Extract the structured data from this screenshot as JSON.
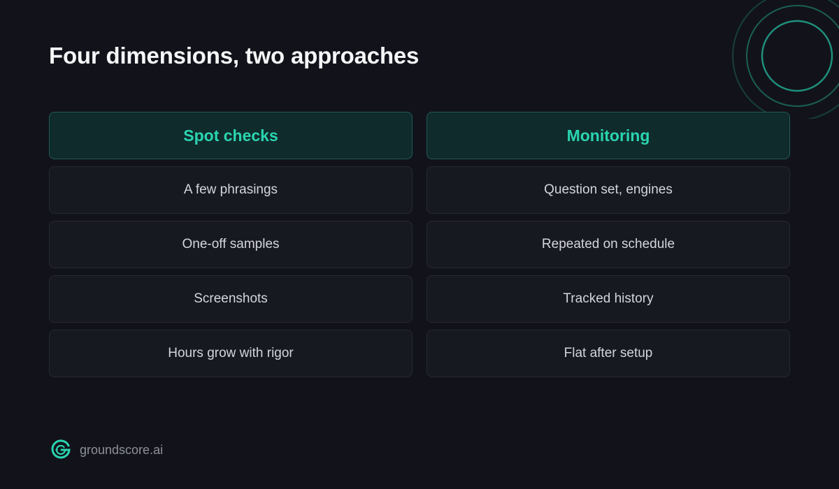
{
  "title": "Four dimensions, two approaches",
  "columns": [
    {
      "header": "Spot checks",
      "rows": [
        "A few phrasings",
        "One-off samples",
        "Screenshots",
        "Hours grow with rigor"
      ]
    },
    {
      "header": "Monitoring",
      "rows": [
        "Question set, engines",
        "Repeated on schedule",
        "Tracked history",
        "Flat after setup"
      ]
    }
  ],
  "brand": {
    "name": "groundscore.ai",
    "logo_icon": "groundscore-g-logo-icon",
    "decoration_icon": "concentric-arcs-icon"
  },
  "colors": {
    "background": "#12131a",
    "accent": "#2ad5b1",
    "header_fill": "#102b2c",
    "cell_fill": "#171920"
  }
}
